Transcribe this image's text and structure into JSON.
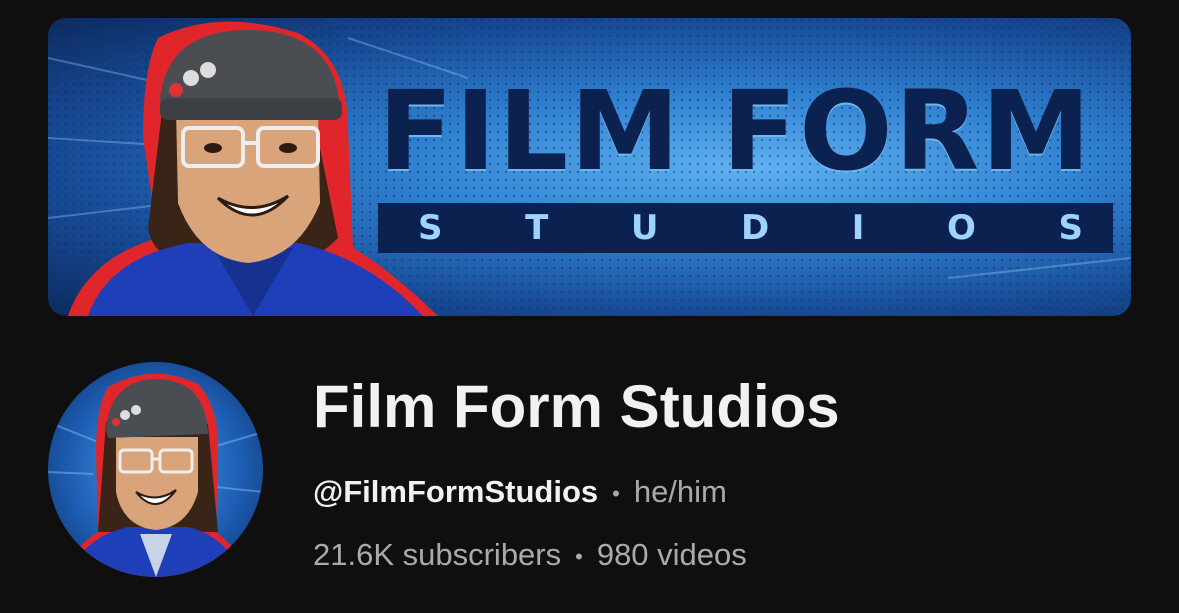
{
  "banner": {
    "title_line": "FILM FORM",
    "subtitle_letters": [
      "S",
      "T",
      "U",
      "D",
      "I",
      "O",
      "S"
    ]
  },
  "channel": {
    "name": "Film Form Studios",
    "handle": "@FilmFormStudios",
    "pronouns": "he/him",
    "subscribers": "21.6K subscribers",
    "videos": "980 videos",
    "separator": "•"
  },
  "colors": {
    "background": "#0f0f0f",
    "primary_text": "#f1f1f1",
    "secondary_text": "#aaaaaa",
    "banner_blue": "#2f80d0",
    "wordmark_navy": "#0b2250"
  }
}
